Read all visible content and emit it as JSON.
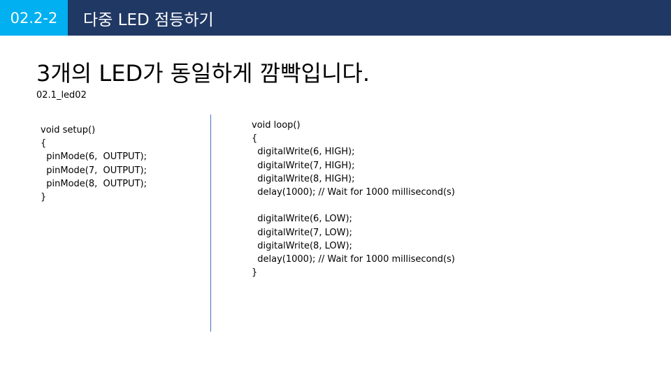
{
  "header": {
    "section_number": "02.2-2",
    "title": "다중 LED 점등하기"
  },
  "slide": {
    "title": "3개의 LED가 동일하게 깜빡입니다.",
    "file_name": "02.1_led02"
  },
  "code": {
    "setup": "void setup()\n{\n  pinMode(6,  OUTPUT);\n  pinMode(7,  OUTPUT);\n  pinMode(8,  OUTPUT);\n}",
    "loop": "void loop()\n{\n  digitalWrite(6, HIGH);\n  digitalWrite(7, HIGH);\n  digitalWrite(8, HIGH);\n  delay(1000); // Wait for 1000 millisecond(s)\n\n  digitalWrite(6, LOW);\n  digitalWrite(7, LOW);\n  digitalWrite(8, LOW);\n  delay(1000); // Wait for 1000 millisecond(s)\n}"
  },
  "colors": {
    "header_bar": "#203864",
    "section_badge": "#00b0f0",
    "divider": "#4472c4"
  }
}
